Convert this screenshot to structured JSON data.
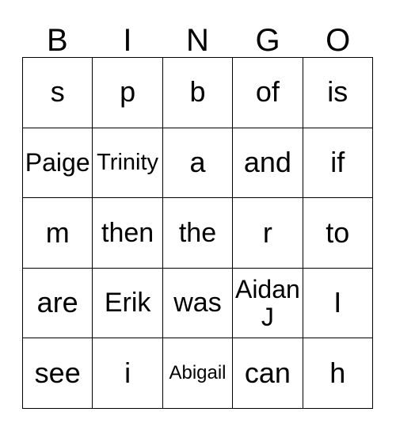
{
  "card": {
    "title": "BINGO",
    "header": {
      "letters": [
        "B",
        "I",
        "N",
        "G",
        "O"
      ]
    },
    "colors": {
      "border": "#000000",
      "cell_background": "#ffffff",
      "text": "#000000"
    },
    "grid": {
      "columns": 5,
      "rows": 5,
      "cells": [
        [
          {
            "text": "s",
            "size": "fs-xl"
          },
          {
            "text": "p",
            "size": "fs-xl"
          },
          {
            "text": "b",
            "size": "fs-xl"
          },
          {
            "text": "of",
            "size": "fs-xl"
          },
          {
            "text": "is",
            "size": "fs-xl"
          }
        ],
        [
          {
            "text": "Paige",
            "size": "fs-md"
          },
          {
            "text": "Trinity",
            "size": "fs-sm"
          },
          {
            "text": "a",
            "size": "fs-xl"
          },
          {
            "text": "and",
            "size": "fs-xl"
          },
          {
            "text": "if",
            "size": "fs-xl"
          }
        ],
        [
          {
            "text": "m",
            "size": "fs-xl"
          },
          {
            "text": "then",
            "size": "fs-lg"
          },
          {
            "text": "the",
            "size": "fs-lg"
          },
          {
            "text": "r",
            "size": "fs-xl"
          },
          {
            "text": "to",
            "size": "fs-xl"
          }
        ],
        [
          {
            "text": "are",
            "size": "fs-xl"
          },
          {
            "text": "Erik",
            "size": "fs-lg"
          },
          {
            "text": "was",
            "size": "fs-lg"
          },
          {
            "text": "Aidan J",
            "size": "fs-md"
          },
          {
            "text": "I",
            "size": "fs-xl"
          }
        ],
        [
          {
            "text": "see",
            "size": "fs-xl"
          },
          {
            "text": "i",
            "size": "fs-xl"
          },
          {
            "text": "Abigail",
            "size": "fs-xs"
          },
          {
            "text": "can",
            "size": "fs-xl"
          },
          {
            "text": "h",
            "size": "fs-xl"
          }
        ]
      ]
    }
  }
}
